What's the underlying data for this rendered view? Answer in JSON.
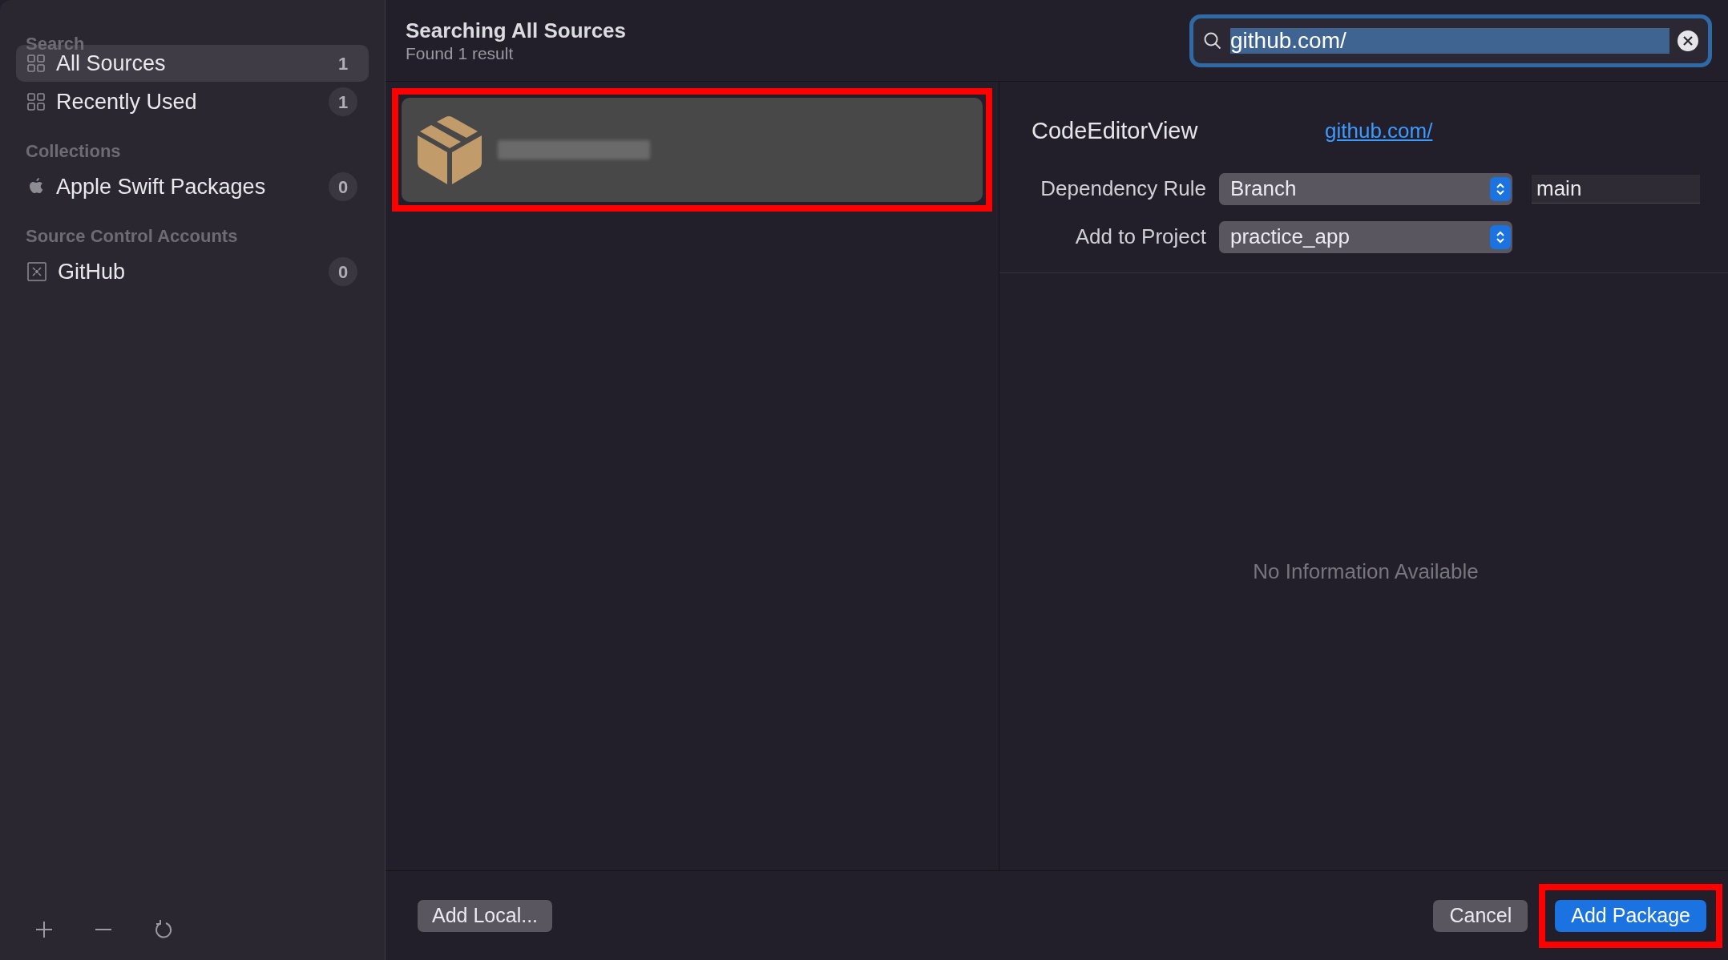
{
  "sidebar": {
    "sections": [
      {
        "title": "Search",
        "items": [
          {
            "label": "All Sources",
            "count": "1",
            "kind": "grid",
            "selected": true
          },
          {
            "label": "Recently Used",
            "count": "1",
            "kind": "grid",
            "selected": false
          }
        ]
      },
      {
        "title": "Collections",
        "items": [
          {
            "label": "Apple Swift Packages",
            "count": "0",
            "kind": "apple",
            "selected": false
          }
        ]
      },
      {
        "title": "Source Control Accounts",
        "items": [
          {
            "label": "GitHub",
            "count": "0",
            "kind": "account",
            "selected": false
          }
        ]
      }
    ],
    "toolbar": [
      {
        "kind": "add"
      },
      {
        "kind": "remove"
      },
      {
        "kind": "refresh"
      }
    ]
  },
  "header": {
    "title": "Searching All Sources",
    "subtitle": "Found 1 result"
  },
  "search": {
    "value": "github.com/"
  },
  "results": [
    {
      "kind": "package",
      "name_redacted": true,
      "selected": true,
      "highlighted": true
    }
  ],
  "details": {
    "name": "CodeEditorView",
    "link": "github.com/",
    "fields": [
      {
        "label": "Dependency Rule",
        "value": "Branch",
        "extra": "main"
      },
      {
        "label": "Add to Project",
        "value": "practice_app"
      }
    ],
    "empty_message": "No Information Available"
  },
  "footer": {
    "left_button": "Add Local...",
    "cancel": "Cancel",
    "primary": "Add Package",
    "primary_highlighted": true
  }
}
